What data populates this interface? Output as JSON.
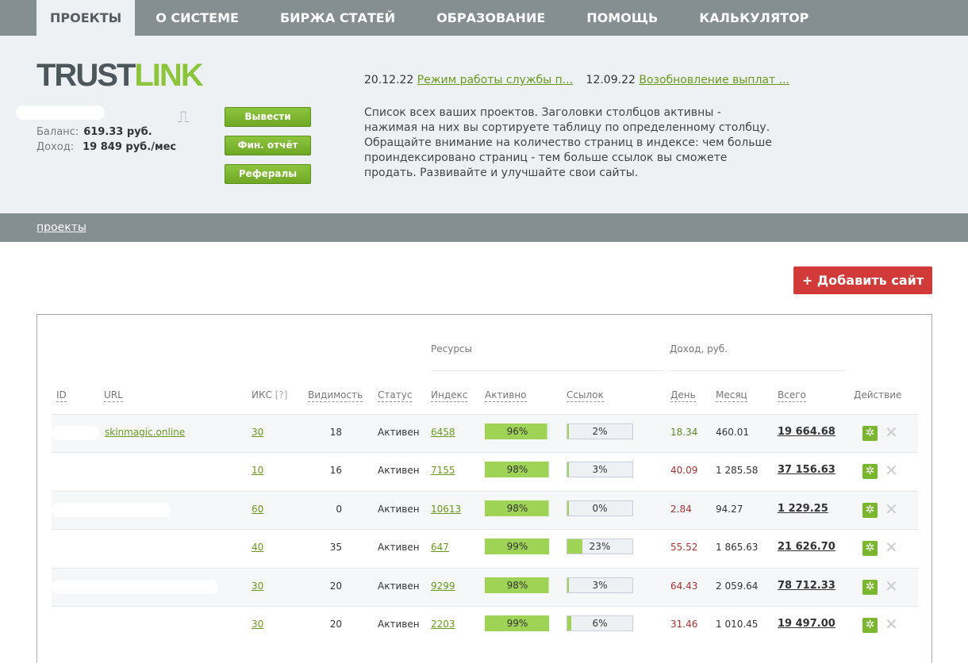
{
  "nav": [
    "ПРОЕКТЫ",
    "О СИСТЕМЕ",
    "БИРЖА СТАТЕЙ",
    "ОБРАЗОВАНИЕ",
    "ПОМОЩЬ",
    "КАЛЬКУЛЯТОР"
  ],
  "logo": {
    "a": "TRUST",
    "b": "LINK"
  },
  "account": {
    "balance_label": "Баланс:",
    "balance": "619.33  руб.",
    "income_label": "Доход:",
    "income": "19 849 руб./мес"
  },
  "buttons": {
    "withdraw": "Вывести",
    "report": "Фин. отчёт",
    "referrals": "Рефералы",
    "add_site": "+ Добавить сайт"
  },
  "news": [
    {
      "date": "20.12.22",
      "title": "Режим работы службы п..."
    },
    {
      "date": "12.09.22",
      "title": "Возобновление выплат ..."
    }
  ],
  "description": "Список всех ваших проектов. Заголовки столбцов активны - нажимая на них вы сортируете таблицу по определенному столбцу. Обращайте внимание на количество страниц в индексе: чем больше проиндексировано страниц - тем больше ссылок вы сможете продать. Развивайте и улучшайте свои сайты.",
  "breadcrumb": "проекты",
  "table": {
    "groups": {
      "resources": "Ресурсы",
      "income": "Доход,  руб."
    },
    "headers": {
      "id": "ID",
      "url": "URL",
      "iks": "ИКС",
      "iks_help": "[?]",
      "visibility": "Видимость",
      "status": "Статус",
      "index": "Индекс",
      "active": "Активно",
      "links": "Ссылок",
      "day": "День",
      "month": "Месяц",
      "total": "Всего",
      "action": "Действие"
    },
    "rows": [
      {
        "url": "skinmagic.online",
        "iks": "30",
        "visibility": "18",
        "status": "Активен",
        "index": "6458",
        "active": 96,
        "active_label": "96%",
        "links": 2,
        "links_label": "2%",
        "day": "18.34",
        "month": "460.01",
        "total": "19 664.68",
        "day_color": "#5a8a2a"
      },
      {
        "url": "",
        "iks": "10",
        "visibility": "16",
        "status": "Активен",
        "index": "7155",
        "active": 98,
        "active_label": "98%",
        "links": 3,
        "links_label": "3%",
        "day": "40.09",
        "month": "1 285.58",
        "total": "37 156.63",
        "day_color": "#a33"
      },
      {
        "url": "",
        "iks": "60",
        "visibility": "0",
        "status": "Активен",
        "index": "10613",
        "active": 98,
        "active_label": "98%",
        "links": 0,
        "links_label": "0%",
        "day": "2.84",
        "month": "94.27",
        "total": "1 229.25",
        "day_color": "#a33"
      },
      {
        "url": "",
        "iks": "40",
        "visibility": "35",
        "status": "Активен",
        "index": "647",
        "active": 99,
        "active_label": "99%",
        "links": 23,
        "links_label": "23%",
        "day": "55.52",
        "month": "1 865.63",
        "total": "21 626.70",
        "day_color": "#a33"
      },
      {
        "url": "",
        "iks": "30",
        "visibility": "20",
        "status": "Активен",
        "index": "9299",
        "active": 98,
        "active_label": "98%",
        "links": 3,
        "links_label": "3%",
        "day": "64.43",
        "month": "2 059.64",
        "total": "78 712.33",
        "day_color": "#a33"
      },
      {
        "url": "",
        "iks": "30",
        "visibility": "20",
        "status": "Активен",
        "index": "2203",
        "active": 99,
        "active_label": "99%",
        "links": 6,
        "links_label": "6%",
        "day": "31.46",
        "month": "1 010.45",
        "total": "19 497.00",
        "day_color": "#a33"
      }
    ]
  }
}
